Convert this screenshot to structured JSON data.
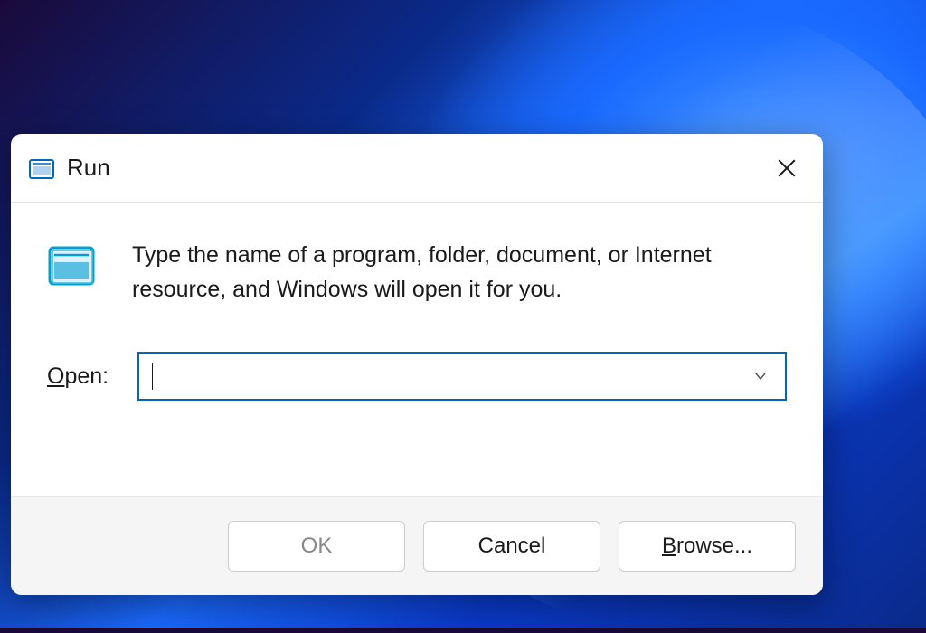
{
  "dialog": {
    "title": "Run",
    "description": "Type the name of a program, folder, document, or Internet resource, and Windows will open it for you.",
    "open_label_underline": "O",
    "open_label_rest": "pen:",
    "input_value": "",
    "buttons": {
      "ok": "OK",
      "cancel": "Cancel",
      "browse_underline": "B",
      "browse_rest": "rowse..."
    }
  }
}
